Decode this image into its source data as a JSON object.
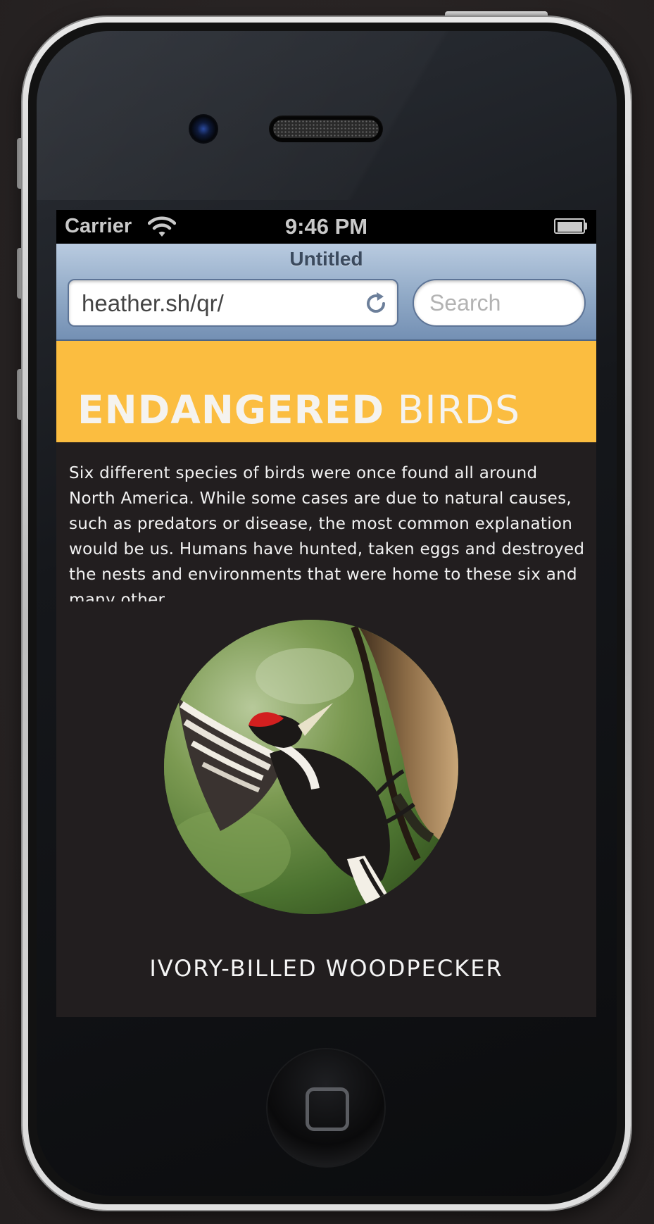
{
  "status_bar": {
    "carrier": "Carrier",
    "time": "9:46 PM"
  },
  "browser": {
    "page_title": "Untitled",
    "url": "heather.sh/qr/",
    "search_placeholder": "Search"
  },
  "hero": {
    "title_bold": "ENDANGERED",
    "title_light": "BIRDS",
    "background_color": "#fbbd40"
  },
  "intro_text": "Six different species of birds were once found all around North America. While some cases are due to natural causes, such as predators or disease, the most common explanation would be us. Humans have hunted, taken eggs and destroyed the nests and environments that were home to these six and many other",
  "bird": {
    "caption": "IVORY-BILLED WOODPECKER"
  },
  "colors": {
    "page_background": "#221e1f",
    "browser_bar": "#90a9c6"
  }
}
